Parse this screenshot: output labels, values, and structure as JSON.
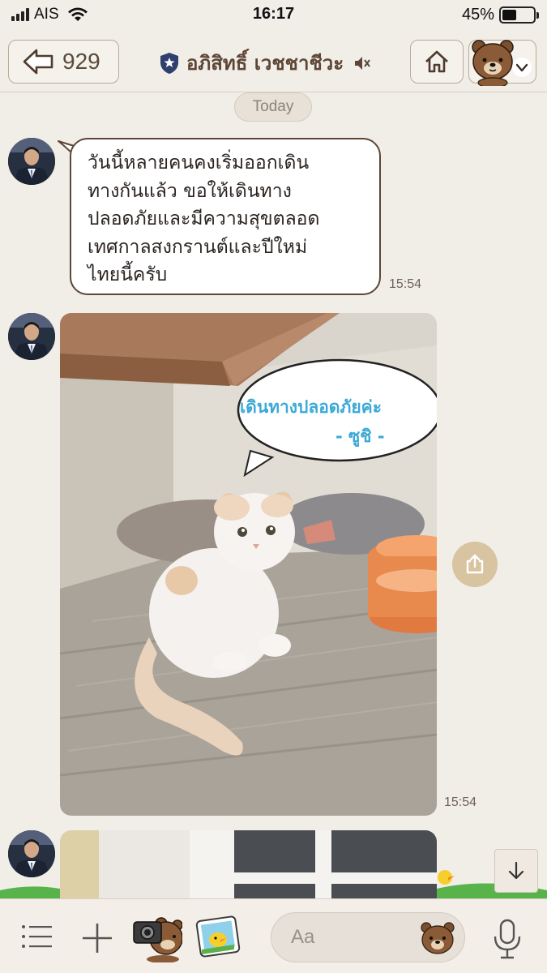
{
  "status_bar": {
    "carrier": "AIS",
    "time": "16:17",
    "battery_percent_label": "45%",
    "battery_level": 0.45
  },
  "header": {
    "back_count": "929",
    "title": "อภิสิทธิ์ เวชชาชีวะ",
    "icons": [
      "back-arrow-icon",
      "shield-icon",
      "mute-icon",
      "home-icon",
      "bear-avatar-icon",
      "chevron-down-icon"
    ]
  },
  "date_separator": "Today",
  "messages": [
    {
      "type": "text",
      "text": "วันนี้หลายคนคงเริ่มออกเดิน\nทางกันแล้ว ขอให้เดินทาง\nปลอดภัยและมีความสุขตลอด\nเทศกาลสงกรานต์และปีใหม่\nไทยนี้ครับ",
      "time": "15:54"
    },
    {
      "type": "image",
      "caption_line1": "เดินทางปลอดภัยค่ะ",
      "caption_line2": "- ซูชิ -",
      "time": "15:54"
    },
    {
      "type": "image"
    }
  ],
  "composer": {
    "placeholder": "Aa",
    "icons": [
      "menu-icon",
      "plus-icon",
      "camera-bear-icon",
      "gallery-icon",
      "sticker-icon",
      "mic-icon"
    ]
  },
  "colors": {
    "background": "#f1ede7",
    "bubble_border": "#5d4636",
    "caption_blue": "#3aa9d6",
    "share_button": "#d8c4a0"
  }
}
